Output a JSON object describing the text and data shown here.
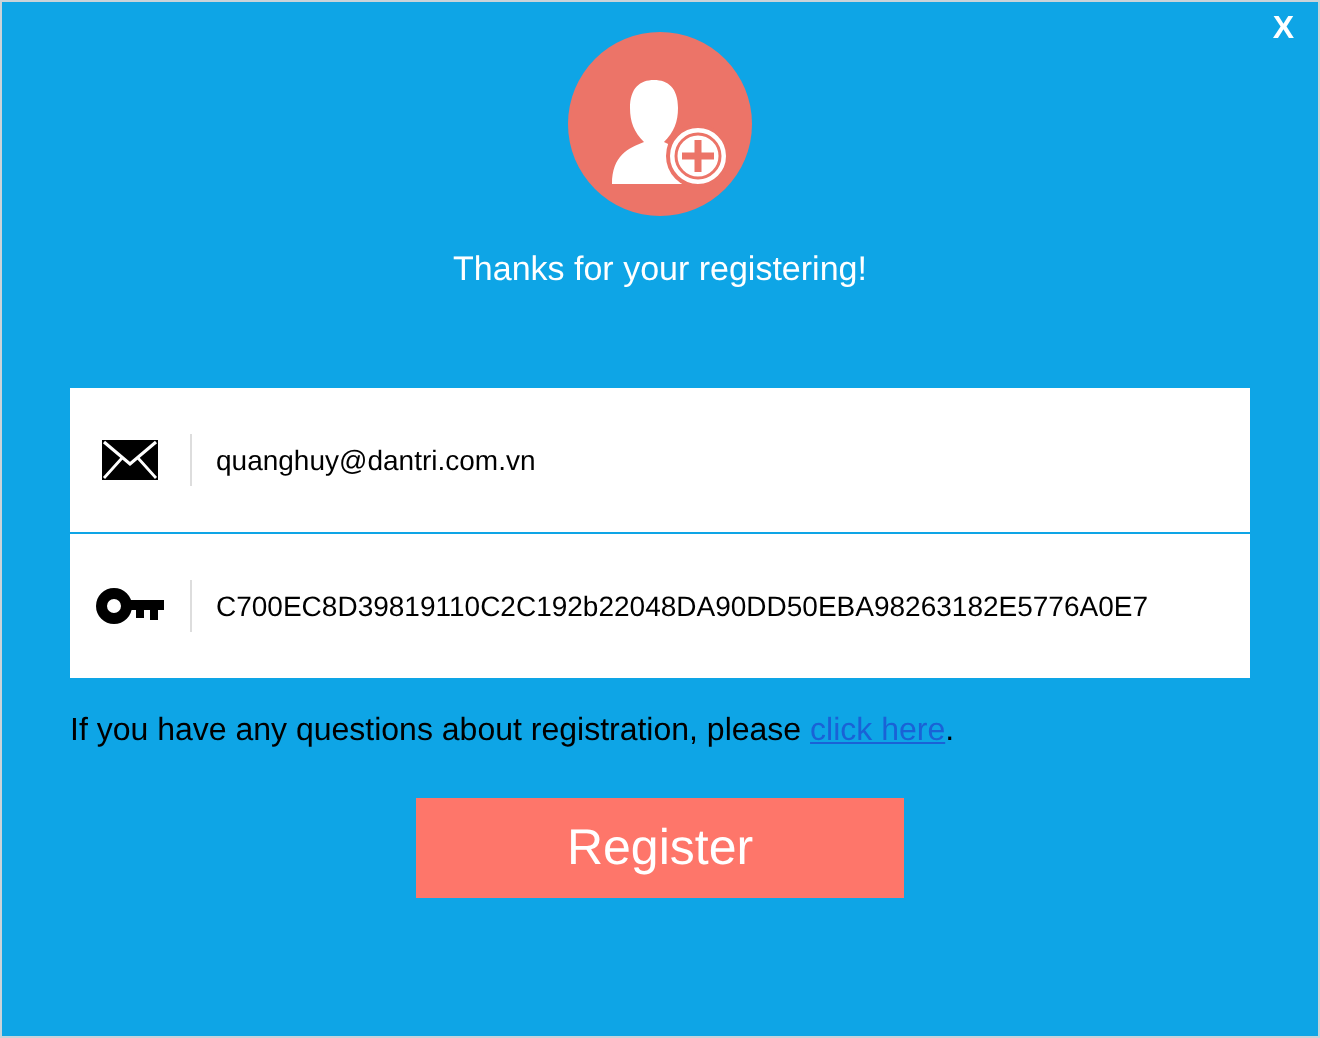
{
  "close_button": "X",
  "message": "Thanks for your registering!",
  "fields": [
    {
      "kind": "email",
      "value": "quanghuy@dantri.com.vn"
    },
    {
      "kind": "key",
      "value": "C700EC8D39819110C2C192b22048DA90DD50EBA98263182E5776A0E7"
    }
  ],
  "help": {
    "before": "If you have any questions about registration, please ",
    "link": "click here",
    "after": "."
  },
  "register_button": "Register"
}
